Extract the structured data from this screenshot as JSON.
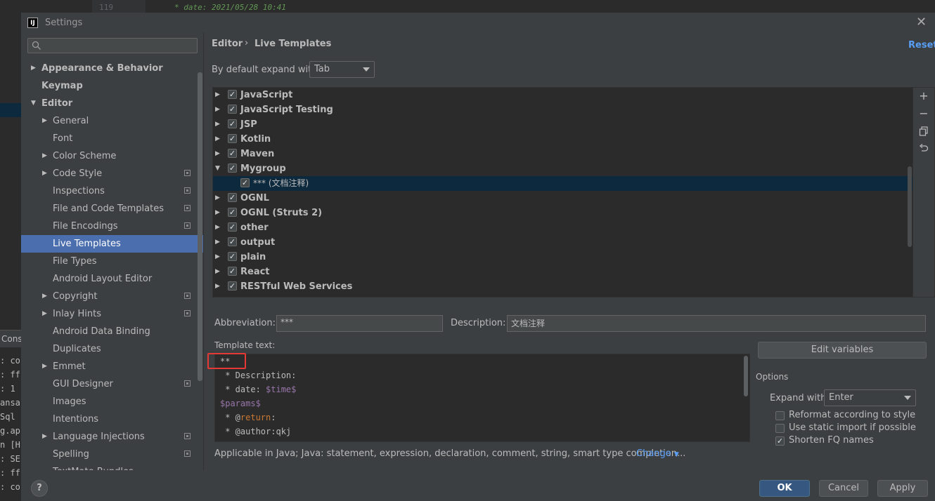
{
  "background": {
    "line_number": "119",
    "code_line": "* date: 2021/05/28 10:41",
    "console_tab": "Conso",
    "console_lines": [
      ": co",
      ": ff",
      ": 1",
      "ansa",
      "Sql",
      "g.ap",
      "n [H",
      ": SE",
      ": ff",
      ": co"
    ]
  },
  "dialog": {
    "title": "Settings",
    "app_icon": "IJ",
    "close_icon": "close-icon",
    "colors": {
      "accent": "#4b6eaf",
      "link": "#589df6",
      "highlight": "#e53935"
    }
  },
  "sidebar": {
    "search_placeholder": "",
    "items": [
      {
        "label": "Appearance & Behavior",
        "bold": true,
        "arrow": "right",
        "indent": 0
      },
      {
        "label": "Keymap",
        "bold": true,
        "arrow": "",
        "indent": 0
      },
      {
        "label": "Editor",
        "bold": true,
        "arrow": "down",
        "indent": 0
      },
      {
        "label": "General",
        "arrow": "right",
        "indent": 1
      },
      {
        "label": "Font",
        "arrow": "",
        "indent": 1
      },
      {
        "label": "Color Scheme",
        "arrow": "right",
        "indent": 1
      },
      {
        "label": "Code Style",
        "arrow": "right",
        "indent": 1,
        "project": true
      },
      {
        "label": "Inspections",
        "arrow": "",
        "indent": 1,
        "project": true
      },
      {
        "label": "File and Code Templates",
        "arrow": "",
        "indent": 1,
        "project": true
      },
      {
        "label": "File Encodings",
        "arrow": "",
        "indent": 1,
        "project": true
      },
      {
        "label": "Live Templates",
        "arrow": "",
        "indent": 1,
        "selected": true
      },
      {
        "label": "File Types",
        "arrow": "",
        "indent": 1
      },
      {
        "label": "Android Layout Editor",
        "arrow": "",
        "indent": 1
      },
      {
        "label": "Copyright",
        "arrow": "right",
        "indent": 1,
        "project": true
      },
      {
        "label": "Inlay Hints",
        "arrow": "right",
        "indent": 1,
        "project": true
      },
      {
        "label": "Android Data Binding",
        "arrow": "",
        "indent": 1
      },
      {
        "label": "Duplicates",
        "arrow": "",
        "indent": 1
      },
      {
        "label": "Emmet",
        "arrow": "right",
        "indent": 1
      },
      {
        "label": "GUI Designer",
        "arrow": "",
        "indent": 1,
        "project": true
      },
      {
        "label": "Images",
        "arrow": "",
        "indent": 1
      },
      {
        "label": "Intentions",
        "arrow": "",
        "indent": 1
      },
      {
        "label": "Language Injections",
        "arrow": "right",
        "indent": 1,
        "project": true
      },
      {
        "label": "Spelling",
        "arrow": "",
        "indent": 1,
        "project": true
      },
      {
        "label": "TextMate Bundles",
        "arrow": "",
        "indent": 1
      }
    ]
  },
  "breadcrumb": {
    "editor": "Editor",
    "separator": "›",
    "current": "Live Templates",
    "reset": "Reset"
  },
  "expand": {
    "label": "By default expand with",
    "value": "Tab"
  },
  "templates": [
    {
      "label": "JavaScript",
      "arrow": "right",
      "checked": true
    },
    {
      "label": "JavaScript Testing",
      "arrow": "right",
      "checked": true
    },
    {
      "label": "JSP",
      "arrow": "right",
      "checked": true
    },
    {
      "label": "Kotlin",
      "arrow": "right",
      "checked": true
    },
    {
      "label": "Maven",
      "arrow": "right",
      "checked": true
    },
    {
      "label": "Mygroup",
      "arrow": "down",
      "checked": true
    },
    {
      "label": "*** (文档注释)",
      "arrow": "",
      "checked": true,
      "child": true,
      "selected": true
    },
    {
      "label": "OGNL",
      "arrow": "right",
      "checked": true
    },
    {
      "label": "OGNL (Struts 2)",
      "arrow": "right",
      "checked": true
    },
    {
      "label": "other",
      "arrow": "right",
      "checked": true
    },
    {
      "label": "output",
      "arrow": "right",
      "checked": true
    },
    {
      "label": "plain",
      "arrow": "right",
      "checked": true
    },
    {
      "label": "React",
      "arrow": "right",
      "checked": true
    },
    {
      "label": "RESTful Web Services",
      "arrow": "right",
      "checked": true
    }
  ],
  "toolbar": {
    "add": "+",
    "remove": "−",
    "copy_icon": "copy-icon",
    "restore_icon": "restore-icon"
  },
  "abbreviation": {
    "label": "Abbreviation:",
    "value": "***"
  },
  "description": {
    "label": "Description:",
    "value": "文档注释"
  },
  "template_text": {
    "label": "Template text:",
    "lines": [
      {
        "text": "**"
      },
      {
        "text": " * Description:"
      },
      {
        "pre": " * date: ",
        "var": "$time$"
      },
      {
        "var": "$params$"
      },
      {
        "pre": " * @",
        "kw": "return",
        "post": ":"
      },
      {
        "text": " * @author:qkj"
      }
    ]
  },
  "edit_variables": "Edit variables",
  "options": {
    "label": "Options",
    "expand_label": "Expand with",
    "expand_value": "Enter",
    "checkboxes": [
      {
        "label": "Reformat according to style",
        "checked": false
      },
      {
        "label": "Use static import if possible",
        "checked": false
      },
      {
        "label": "Shorten FQ names",
        "checked": true
      }
    ]
  },
  "applicable": {
    "text": "Applicable in Java; Java: statement, expression, declaration, comment, string, smart type completion...",
    "change": "Change"
  },
  "footer": {
    "help": "?",
    "ok": "OK",
    "cancel": "Cancel",
    "apply": "Apply"
  }
}
